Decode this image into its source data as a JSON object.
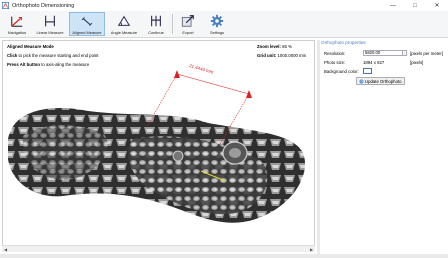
{
  "window": {
    "title": "Orthophoto Dimensioning",
    "minimize": "—",
    "maximize": "□",
    "close": "✕"
  },
  "toolbar": [
    {
      "label": "Navigation",
      "icon": "navigation-icon"
    },
    {
      "label": "Linear Measure",
      "icon": "linear-measure-icon"
    },
    {
      "label": "Aligned Measure",
      "icon": "aligned-measure-icon",
      "active": true
    },
    {
      "label": "Angle Measure",
      "icon": "angle-measure-icon"
    },
    {
      "label": "Continue",
      "icon": "continue-icon"
    },
    {
      "label": "Export",
      "icon": "export-icon"
    },
    {
      "label": "Settings",
      "icon": "settings-icon"
    }
  ],
  "viewport": {
    "mode_title": "Aligned Measure Mode",
    "instruction_key": "Click",
    "instruction_text": "to pick the measure starting and end point",
    "hint_key": "Press Alt button",
    "hint_text": "to axis-aling the measure",
    "zoom_label": "Zoom level:",
    "zoom_value": "65 %",
    "grid_label": "Grid unit:",
    "grid_value": "1000.0000 mm",
    "measurement_label": "21.4444 mm"
  },
  "properties": {
    "title": "Orthophoto properties",
    "resolution_label": "Resolution:",
    "resolution_value": "5820.00",
    "resolution_unit": "[pixels per meter]",
    "photo_size_label": "Photo size:",
    "photo_size_value": "1894 x 827",
    "photo_size_unit": "[pixels]",
    "background_label": "Background color:",
    "background_color": "#ffffff",
    "update_button": "Update Orthophoto"
  },
  "colors": {
    "accent": "#4a7fc0",
    "measure": "#e02020",
    "active_tool": "#cde4f7"
  }
}
